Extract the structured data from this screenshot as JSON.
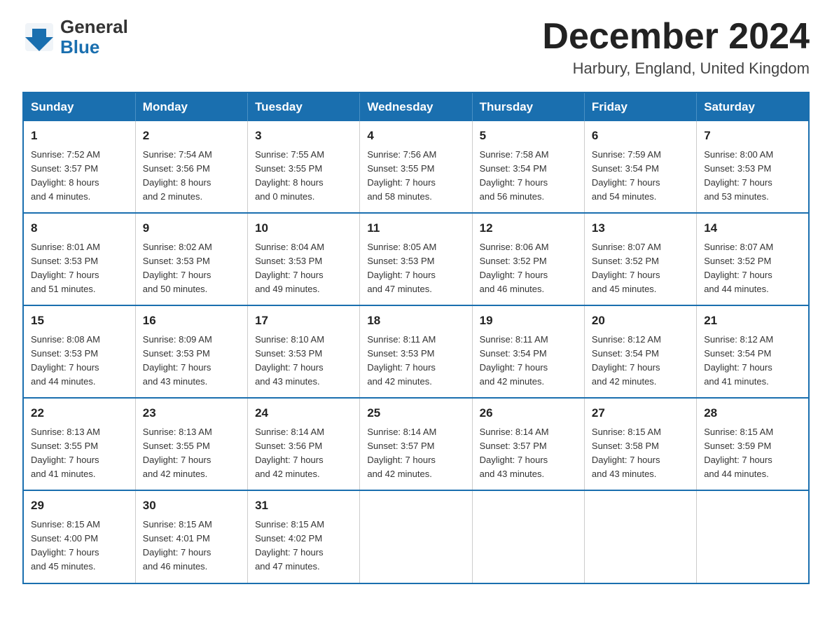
{
  "header": {
    "logo_line1": "General",
    "logo_line2": "Blue",
    "month_title": "December 2024",
    "location": "Harbury, England, United Kingdom"
  },
  "days_of_week": [
    "Sunday",
    "Monday",
    "Tuesday",
    "Wednesday",
    "Thursday",
    "Friday",
    "Saturday"
  ],
  "weeks": [
    [
      {
        "day": "1",
        "sunrise": "7:52 AM",
        "sunset": "3:57 PM",
        "daylight": "8 hours and 4 minutes."
      },
      {
        "day": "2",
        "sunrise": "7:54 AM",
        "sunset": "3:56 PM",
        "daylight": "8 hours and 2 minutes."
      },
      {
        "day": "3",
        "sunrise": "7:55 AM",
        "sunset": "3:55 PM",
        "daylight": "8 hours and 0 minutes."
      },
      {
        "day": "4",
        "sunrise": "7:56 AM",
        "sunset": "3:55 PM",
        "daylight": "7 hours and 58 minutes."
      },
      {
        "day": "5",
        "sunrise": "7:58 AM",
        "sunset": "3:54 PM",
        "daylight": "7 hours and 56 minutes."
      },
      {
        "day": "6",
        "sunrise": "7:59 AM",
        "sunset": "3:54 PM",
        "daylight": "7 hours and 54 minutes."
      },
      {
        "day": "7",
        "sunrise": "8:00 AM",
        "sunset": "3:53 PM",
        "daylight": "7 hours and 53 minutes."
      }
    ],
    [
      {
        "day": "8",
        "sunrise": "8:01 AM",
        "sunset": "3:53 PM",
        "daylight": "7 hours and 51 minutes."
      },
      {
        "day": "9",
        "sunrise": "8:02 AM",
        "sunset": "3:53 PM",
        "daylight": "7 hours and 50 minutes."
      },
      {
        "day": "10",
        "sunrise": "8:04 AM",
        "sunset": "3:53 PM",
        "daylight": "7 hours and 49 minutes."
      },
      {
        "day": "11",
        "sunrise": "8:05 AM",
        "sunset": "3:53 PM",
        "daylight": "7 hours and 47 minutes."
      },
      {
        "day": "12",
        "sunrise": "8:06 AM",
        "sunset": "3:52 PM",
        "daylight": "7 hours and 46 minutes."
      },
      {
        "day": "13",
        "sunrise": "8:07 AM",
        "sunset": "3:52 PM",
        "daylight": "7 hours and 45 minutes."
      },
      {
        "day": "14",
        "sunrise": "8:07 AM",
        "sunset": "3:52 PM",
        "daylight": "7 hours and 44 minutes."
      }
    ],
    [
      {
        "day": "15",
        "sunrise": "8:08 AM",
        "sunset": "3:53 PM",
        "daylight": "7 hours and 44 minutes."
      },
      {
        "day": "16",
        "sunrise": "8:09 AM",
        "sunset": "3:53 PM",
        "daylight": "7 hours and 43 minutes."
      },
      {
        "day": "17",
        "sunrise": "8:10 AM",
        "sunset": "3:53 PM",
        "daylight": "7 hours and 43 minutes."
      },
      {
        "day": "18",
        "sunrise": "8:11 AM",
        "sunset": "3:53 PM",
        "daylight": "7 hours and 42 minutes."
      },
      {
        "day": "19",
        "sunrise": "8:11 AM",
        "sunset": "3:54 PM",
        "daylight": "7 hours and 42 minutes."
      },
      {
        "day": "20",
        "sunrise": "8:12 AM",
        "sunset": "3:54 PM",
        "daylight": "7 hours and 42 minutes."
      },
      {
        "day": "21",
        "sunrise": "8:12 AM",
        "sunset": "3:54 PM",
        "daylight": "7 hours and 41 minutes."
      }
    ],
    [
      {
        "day": "22",
        "sunrise": "8:13 AM",
        "sunset": "3:55 PM",
        "daylight": "7 hours and 41 minutes."
      },
      {
        "day": "23",
        "sunrise": "8:13 AM",
        "sunset": "3:55 PM",
        "daylight": "7 hours and 42 minutes."
      },
      {
        "day": "24",
        "sunrise": "8:14 AM",
        "sunset": "3:56 PM",
        "daylight": "7 hours and 42 minutes."
      },
      {
        "day": "25",
        "sunrise": "8:14 AM",
        "sunset": "3:57 PM",
        "daylight": "7 hours and 42 minutes."
      },
      {
        "day": "26",
        "sunrise": "8:14 AM",
        "sunset": "3:57 PM",
        "daylight": "7 hours and 43 minutes."
      },
      {
        "day": "27",
        "sunrise": "8:15 AM",
        "sunset": "3:58 PM",
        "daylight": "7 hours and 43 minutes."
      },
      {
        "day": "28",
        "sunrise": "8:15 AM",
        "sunset": "3:59 PM",
        "daylight": "7 hours and 44 minutes."
      }
    ],
    [
      {
        "day": "29",
        "sunrise": "8:15 AM",
        "sunset": "4:00 PM",
        "daylight": "7 hours and 45 minutes."
      },
      {
        "day": "30",
        "sunrise": "8:15 AM",
        "sunset": "4:01 PM",
        "daylight": "7 hours and 46 minutes."
      },
      {
        "day": "31",
        "sunrise": "8:15 AM",
        "sunset": "4:02 PM",
        "daylight": "7 hours and 47 minutes."
      },
      null,
      null,
      null,
      null
    ]
  ],
  "labels": {
    "sunrise": "Sunrise:",
    "sunset": "Sunset:",
    "daylight": "Daylight:"
  }
}
